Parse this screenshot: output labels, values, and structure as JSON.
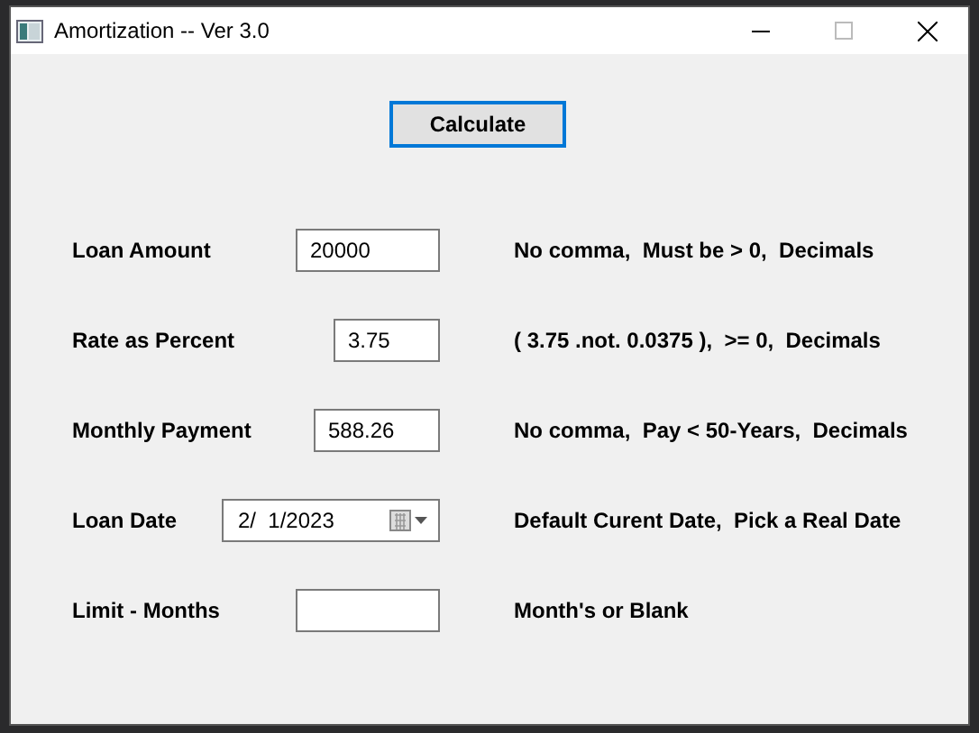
{
  "window": {
    "title": "Amortization -- Ver 3.0"
  },
  "calculate_button": {
    "label": "Calculate",
    "focused": true
  },
  "fields": [
    {
      "kind": "text",
      "label": "Loan Amount",
      "value": "20000",
      "hint": "No comma,  Must be > 0,  Decimals"
    },
    {
      "kind": "text",
      "label": "Rate as Percent",
      "value": "3.75",
      "hint": "( 3.75 .not. 0.0375 ),  >= 0,  Decimals"
    },
    {
      "kind": "text",
      "label": "Monthly Payment",
      "value": "588.26",
      "hint": "No comma,  Pay < 50-Years,  Decimals"
    },
    {
      "kind": "date",
      "label": "Loan Date",
      "value": "2/  1/2023",
      "hint": "Default Curent Date,  Pick a Real Date"
    },
    {
      "kind": "text",
      "label": "Limit - Months",
      "hint": "Month's or Blank"
    }
  ]
}
